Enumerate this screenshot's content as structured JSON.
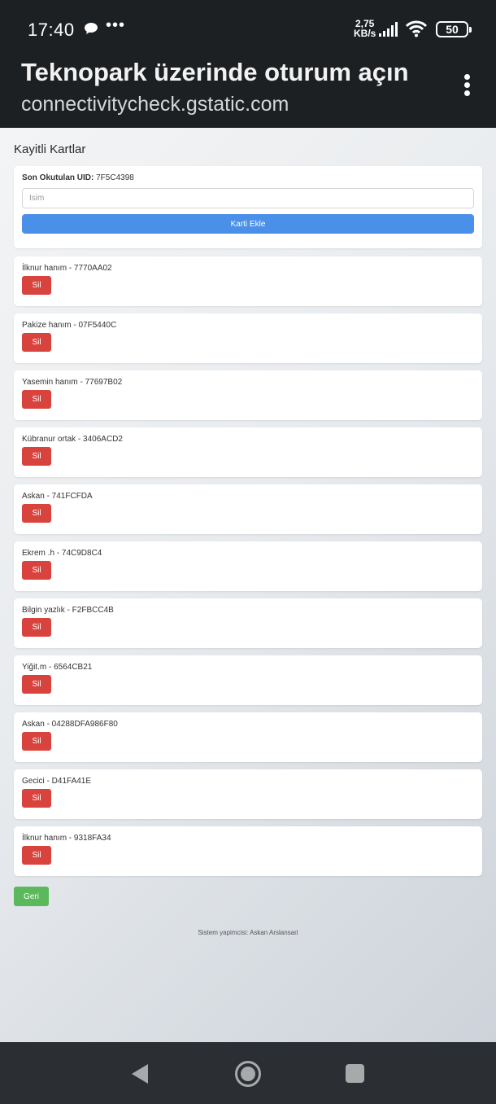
{
  "status_bar": {
    "time": "17:40",
    "message_icon": "chat-bubble-icon",
    "more": "•••",
    "speed_value": "2,75",
    "speed_unit": "KB/s",
    "battery": "50"
  },
  "app_bar": {
    "title": "Teknopark üzerinde oturum açın",
    "subtitle": "connectivitycheck.gstatic.com",
    "menu_icon": "vertical-dots-icon"
  },
  "page": {
    "section_title": "Kayitli Kartlar",
    "form": {
      "uid_label": "Son Okutulan UID:",
      "uid_value": "7F5C4398",
      "name_placeholder": "Isim",
      "add_button": "Karti Ekle"
    },
    "cards": [
      {
        "label": "İlknur hanım - 7770AA02",
        "delete": "Sil"
      },
      {
        "label": "Pakize hanım - 07F5440C",
        "delete": "Sil"
      },
      {
        "label": "Yasemin hanım - 77697B02",
        "delete": "Sil"
      },
      {
        "label": "Kübranur ortak - 3406ACD2",
        "delete": "Sil"
      },
      {
        "label": "Askan - 741FCFDA",
        "delete": "Sil"
      },
      {
        "label": "Ekrem .h - 74C9D8C4",
        "delete": "Sil"
      },
      {
        "label": "Bilgin yazlık - F2FBCC4B",
        "delete": "Sil"
      },
      {
        "label": "Yiğit.m - 6564CB21",
        "delete": "Sil"
      },
      {
        "label": "Askan - 04288DFA986F80",
        "delete": "Sil"
      },
      {
        "label": "Gecici - D41FA41E",
        "delete": "Sil"
      },
      {
        "label": "İlknur hanım - 9318FA34",
        "delete": "Sil"
      }
    ],
    "back_button": "Geri",
    "footer": "Sistem yapimcisi: Askan Arslansari"
  },
  "colors": {
    "add_button": "#4a90e8",
    "delete_button": "#d9433d",
    "back_button": "#5cb85c",
    "header_bg": "#1c2023"
  }
}
